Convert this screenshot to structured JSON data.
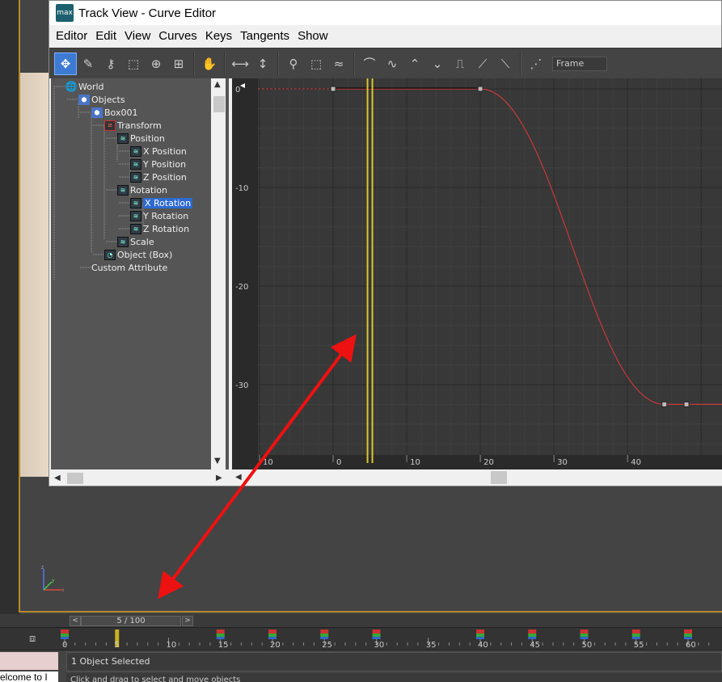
{
  "window": {
    "title": "Track View - Curve Editor",
    "logo_text": "max"
  },
  "menu": [
    "Editor",
    "Edit",
    "View",
    "Curves",
    "Keys",
    "Tangents",
    "Show"
  ],
  "toolbar": {
    "frame_field": "Frame",
    "tools": [
      {
        "name": "move-keys",
        "glyph": "✥",
        "active": true
      },
      {
        "name": "draw-curves",
        "glyph": "✎",
        "active": false
      },
      {
        "name": "add-keys",
        "glyph": "⚷",
        "active": false
      },
      {
        "name": "region-select",
        "glyph": "⬚",
        "active": false
      },
      {
        "name": "retime",
        "glyph": "⊕",
        "active": false
      },
      {
        "name": "retime-global",
        "glyph": "⊞",
        "active": false
      },
      {
        "name": "pan",
        "glyph": "✋",
        "active": false
      },
      {
        "name": "frame-horizontal",
        "glyph": "⟷",
        "active": false
      },
      {
        "name": "frame-value",
        "glyph": "↕",
        "active": false
      },
      {
        "name": "zoom",
        "glyph": "⚲",
        "active": false
      },
      {
        "name": "zoom-region",
        "glyph": "⬚",
        "active": false
      },
      {
        "name": "isolate-curve",
        "glyph": "≈",
        "active": false
      },
      {
        "name": "tangent-auto",
        "glyph": "⌒",
        "active": false
      },
      {
        "name": "tangent-spline",
        "glyph": "∿",
        "active": false
      },
      {
        "name": "tangent-fast",
        "glyph": "⌃",
        "active": false
      },
      {
        "name": "tangent-slow",
        "glyph": "⌄",
        "active": false
      },
      {
        "name": "tangent-step",
        "glyph": "⎍",
        "active": false
      },
      {
        "name": "tangent-linear",
        "glyph": "⟋",
        "active": false
      },
      {
        "name": "tangent-smooth",
        "glyph": "⟍",
        "active": false
      },
      {
        "name": "show-keys",
        "glyph": "⋰",
        "active": false
      }
    ]
  },
  "tree": [
    {
      "label": "World",
      "icon": "globe",
      "depth": 0,
      "selected": false
    },
    {
      "label": "Objects",
      "icon": "box",
      "depth": 1,
      "selected": false
    },
    {
      "label": "Box001",
      "icon": "box",
      "depth": 2,
      "selected": false
    },
    {
      "label": "Transform",
      "icon": "transform",
      "depth": 3,
      "selected": false
    },
    {
      "label": "Position",
      "icon": "track",
      "depth": 4,
      "selected": false
    },
    {
      "label": "X Position",
      "icon": "track",
      "depth": 5,
      "selected": false
    },
    {
      "label": "Y Position",
      "icon": "track",
      "depth": 5,
      "selected": false
    },
    {
      "label": "Z Position",
      "icon": "track",
      "depth": 5,
      "selected": false
    },
    {
      "label": "Rotation",
      "icon": "track",
      "depth": 4,
      "selected": false
    },
    {
      "label": "X Rotation",
      "icon": "track",
      "depth": 5,
      "selected": true
    },
    {
      "label": "Y Rotation",
      "icon": "track",
      "depth": 5,
      "selected": false
    },
    {
      "label": "Z Rotation",
      "icon": "track",
      "depth": 5,
      "selected": false
    },
    {
      "label": "Scale",
      "icon": "track",
      "depth": 4,
      "selected": false
    },
    {
      "label": "Object (Box)",
      "icon": "object",
      "depth": 3,
      "selected": false
    },
    {
      "label": "Custom Attribute",
      "icon": "none",
      "depth": 2,
      "selected": false
    }
  ],
  "chart_data": {
    "type": "line",
    "x_range": [
      -10,
      50
    ],
    "y_range": [
      -35,
      1
    ],
    "y_ticks": [
      0,
      -10,
      -20,
      -30
    ],
    "x_ticks": [
      -10,
      0,
      10,
      20,
      30,
      40
    ],
    "x_tick_labels": [
      "10",
      "0",
      "10",
      "20",
      "30",
      "40"
    ],
    "current_frame": 5,
    "keys": [
      [
        0,
        0
      ],
      [
        20,
        0
      ],
      [
        45,
        -32
      ],
      [
        48,
        -32
      ]
    ],
    "curve_color": "#c8383a",
    "time_marker_color": "#d8c830"
  },
  "time_slider": {
    "label": "5 / 100",
    "prev": "<",
    "next": ">"
  },
  "trackbar": {
    "ticks": [
      "0",
      "5",
      "10",
      "15",
      "20",
      "25",
      "30",
      "35",
      "40",
      "45",
      "50",
      "55",
      "60"
    ],
    "current": 5,
    "key_frames": [
      0,
      15,
      20,
      25,
      30,
      40,
      45,
      50,
      55,
      60
    ]
  },
  "status": {
    "selected": "1 Object Selected",
    "prompt": "Click and drag to select and move objects",
    "maxscript": "elcome to I"
  }
}
